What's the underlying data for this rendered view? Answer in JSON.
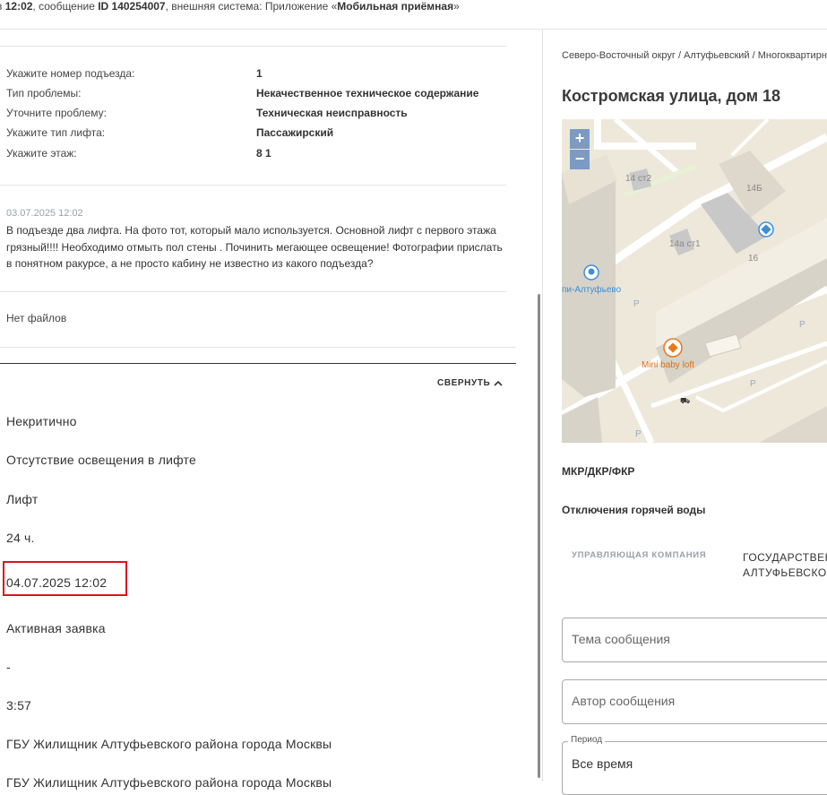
{
  "header": {
    "prefix": "в ",
    "time": "12:02",
    "mid1": ", сообщение ",
    "msg_id": "ID 140254007",
    "mid2": ", внешняя система: Приложение «",
    "system": "Мобильная приёмная",
    "suffix": "»"
  },
  "details": [
    {
      "label": "Укажите номер подъезда:",
      "value": "1"
    },
    {
      "label": "Тип проблемы:",
      "value": "Некачественное техническое содержание"
    },
    {
      "label": "Уточните проблему:",
      "value": "Техническая неисправность"
    },
    {
      "label": "Укажите тип лифта:",
      "value": "Пассажирский"
    },
    {
      "label": "Укажите этаж:",
      "value": "8 1"
    }
  ],
  "comment": {
    "date": "03.07.2025 12:02",
    "text": "В подъезде два лифта. На фото тот, который мало используется. Основной лифт с первого этажа грязный!!!! Необходимо отмыть пол стены . Починить мегающее освещение! Фотографии прислать в понятном ракурсе, а не просто кабину не известно из какого подъезда?"
  },
  "files_text": "Нет файлов",
  "collapse_label": "СВЕРНУТЬ",
  "info_values": [
    "Некритично",
    "Отсутствие освещения в лифте",
    "Лифт",
    "24 ч.",
    "04.07.2025 12:02",
    "Активная заявка",
    "-",
    "3:57",
    "ГБУ Жилищник Алтуфьевского района города Москвы",
    "ГБУ Жилищник Алтуфьевского района города Москвы"
  ],
  "right": {
    "breadcrumb": "Северо-Восточный округ / Алтуфьевский / Многоквартирный дом",
    "address": "Костромская улица, дом 18",
    "map": {
      "zoom_in": "+",
      "zoom_out": "−",
      "labels": {
        "b1": "14 ст2",
        "b2": "14Б",
        "b3": "14а ст1",
        "b4": "16",
        "station": "пи-Алтуфьево",
        "shop": "Mini baby loft",
        "p": "P"
      }
    },
    "section1": "МКР/ДКР/ФКР",
    "section2": "Отключения горячей воды",
    "tab_uk": "УПРАВЛЯЮЩАЯ КОМПАНИЯ",
    "tab_gos_line1": "ГОСУДАРСТВЕННОЕ",
    "tab_gos_line2": "АЛТУФЬЕВСКОГО",
    "field_topic_placeholder": "Тема сообщения",
    "field_author_placeholder": "Автор сообщения",
    "period_legend": "Период",
    "period_value": "Все время"
  },
  "colors": {
    "highlight": "#d9151c",
    "map_bg": "#ede8da",
    "poi_blue": "#3b8fd9",
    "poi_orange": "#e8781f"
  }
}
